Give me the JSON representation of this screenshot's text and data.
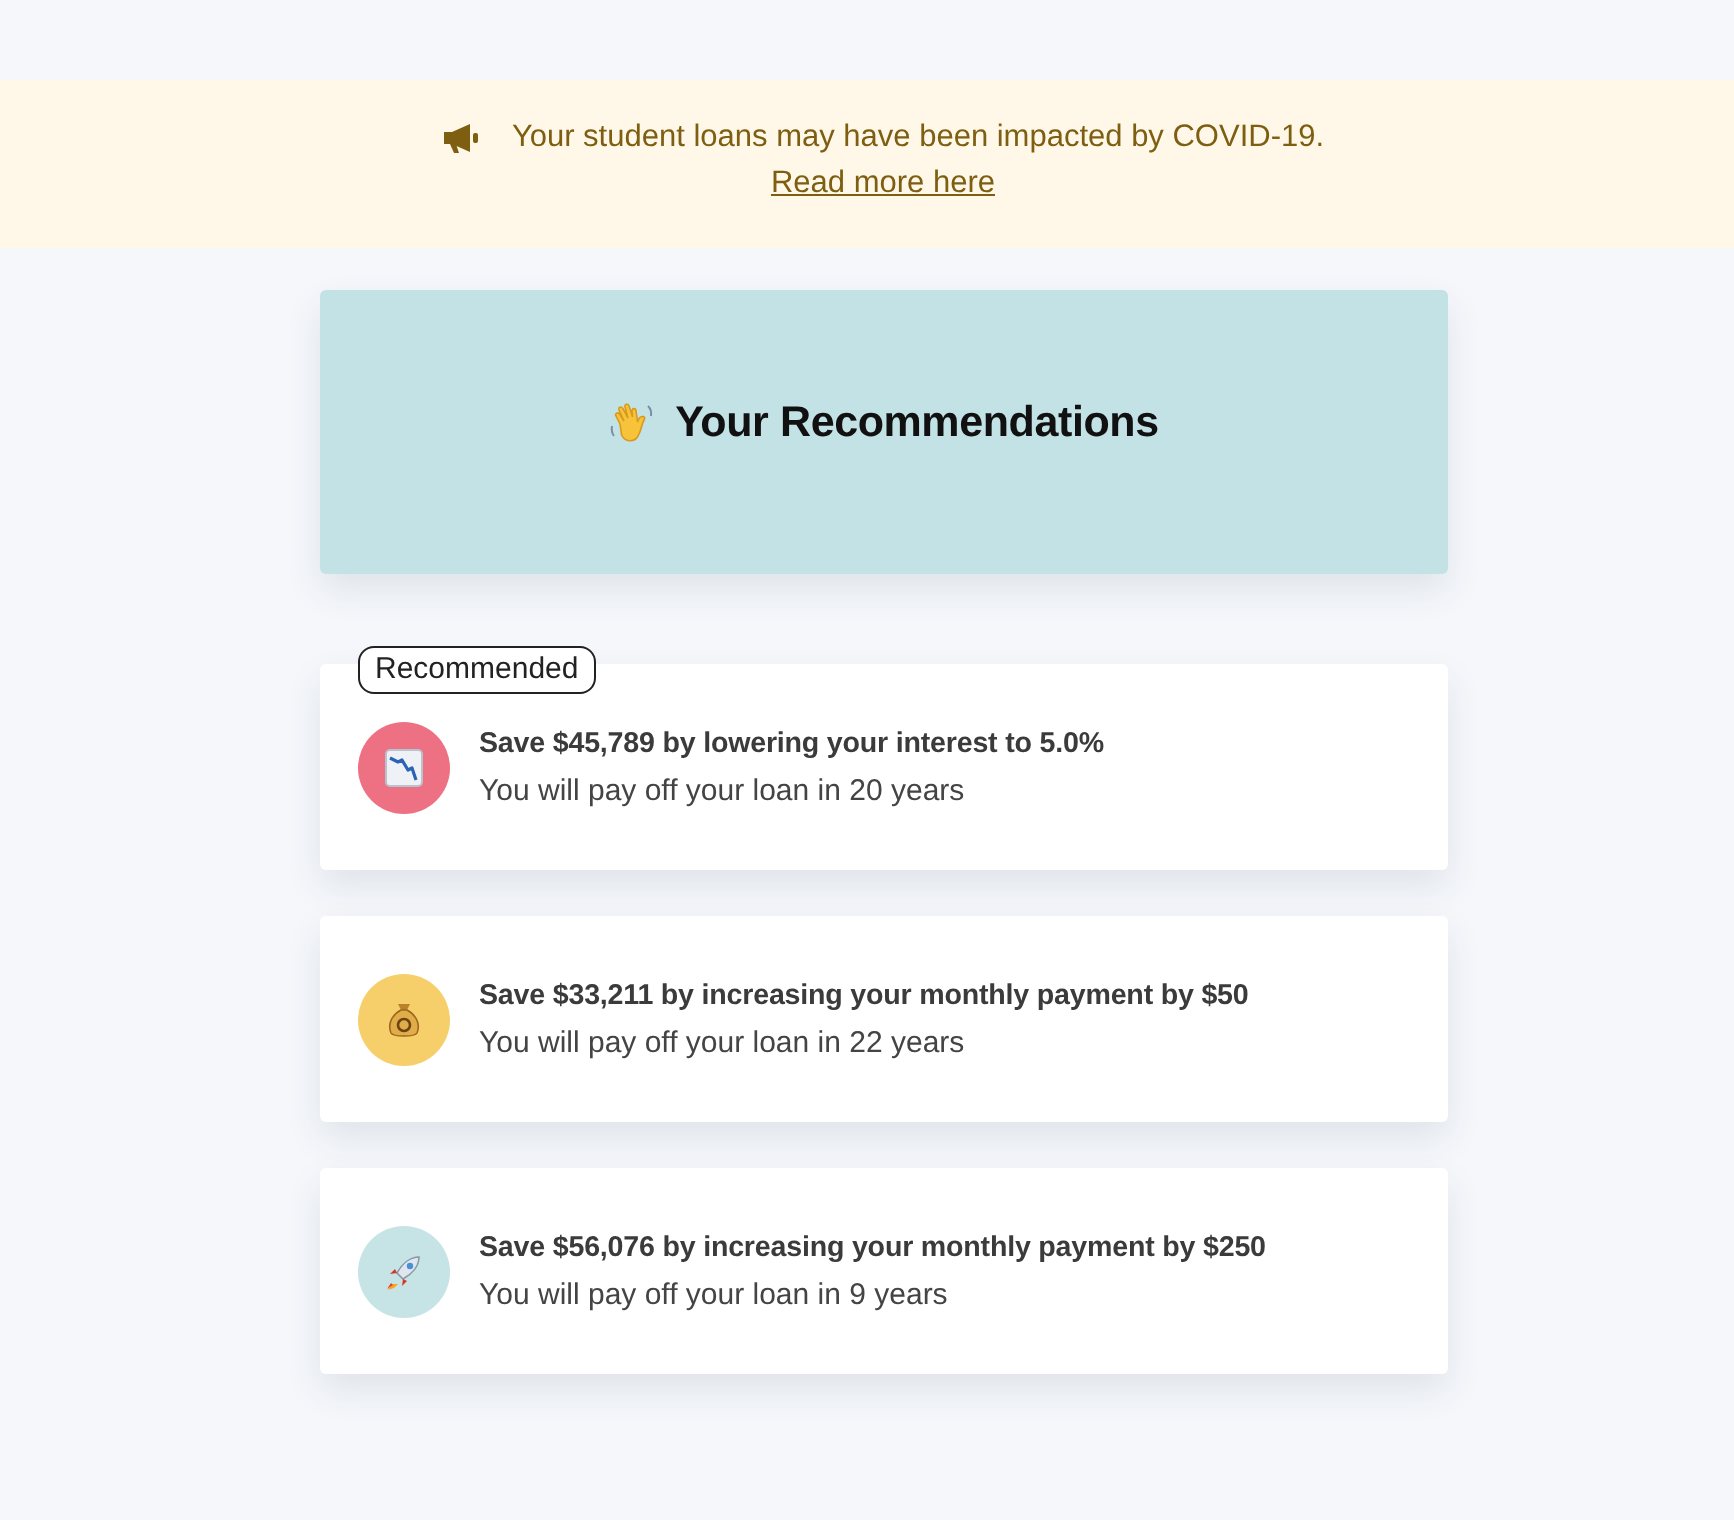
{
  "banner": {
    "message": "Your student loans may have been impacted by COVID-19.",
    "link": "Read more here"
  },
  "header": {
    "title": "Your Recommendations"
  },
  "recommendations": [
    {
      "kind": "chart-down",
      "color": "#ee7083",
      "badge": "Recommended",
      "title": "Save $45,789 by lowering your interest to 5.0%",
      "subtitle": "You will pay off your loan in 20 years"
    },
    {
      "kind": "money-bag",
      "color": "#f6cf6a",
      "title": "Save $33,211 by increasing your monthly payment by $50",
      "subtitle": "You will pay off your loan in 22 years"
    },
    {
      "kind": "rocket",
      "color": "#c6e4e5",
      "title": "Save $56,076 by increasing your monthly payment by $250",
      "subtitle": "You will pay off your loan in 9 years"
    }
  ]
}
